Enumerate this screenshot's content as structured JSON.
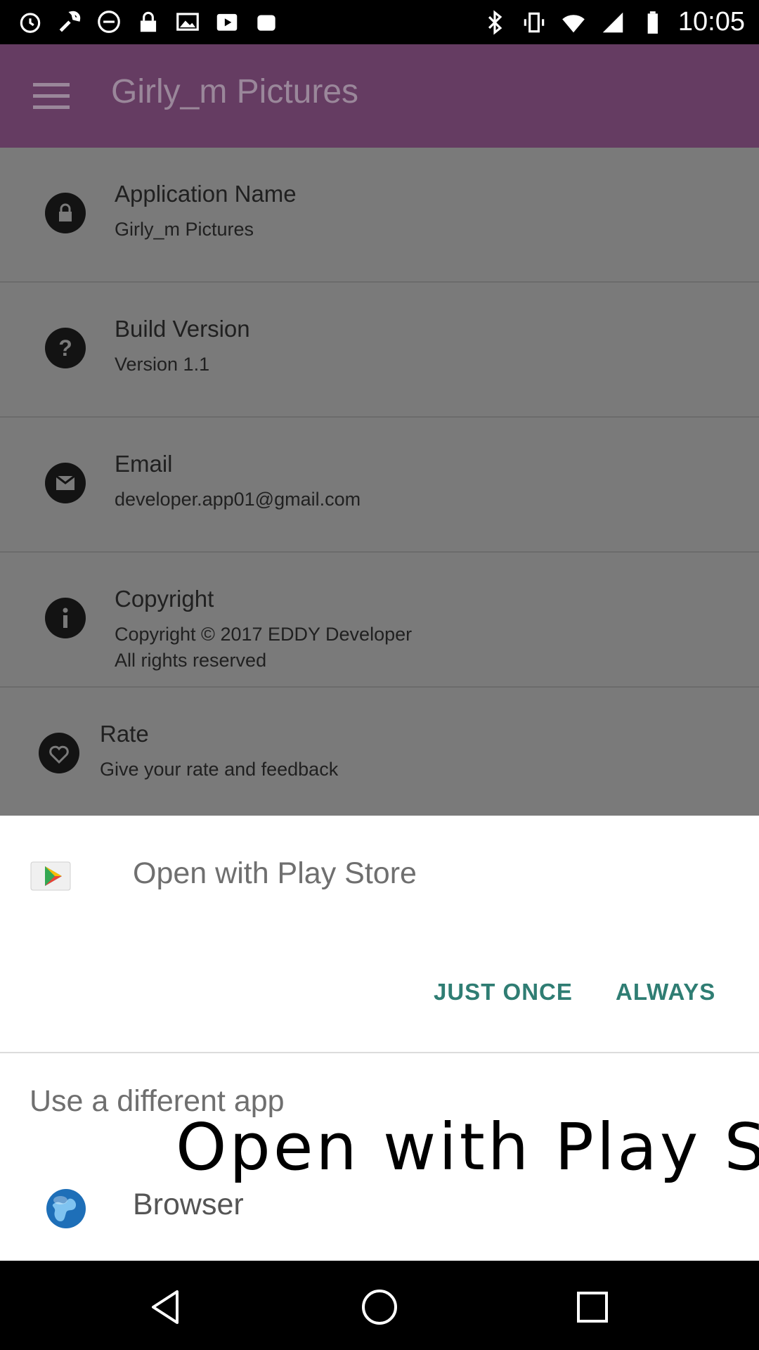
{
  "status_bar": {
    "time": "10:05",
    "left_icons": [
      "alarm-icon",
      "wrench-icon",
      "do-not-disturb-icon",
      "lock-icon",
      "photo-icon",
      "play-store-icon",
      "app-icon"
    ],
    "right_icons": [
      "bluetooth-icon",
      "vibrate-icon",
      "wifi-icon",
      "signal-icon",
      "battery-icon"
    ]
  },
  "app": {
    "title": "Girly_m Pictures",
    "toolbar_color": "#653c62",
    "rows": [
      {
        "icon": "lock-icon",
        "title": "Application Name",
        "subtitle": "Girly_m Pictures"
      },
      {
        "icon": "help-icon",
        "title": "Build Version",
        "subtitle": "Version 1.1"
      },
      {
        "icon": "email-icon",
        "title": "Email",
        "subtitle": "developer.app01@gmail.com"
      },
      {
        "icon": "info-icon",
        "title": "Copyright",
        "subtitle": "Copyright © 2017 EDDY Developer\n All rights reserved"
      },
      {
        "icon": "heart-icon",
        "title": "Rate",
        "subtitle": "Give your rate and feedback"
      }
    ]
  },
  "dialog": {
    "title": "Open with Play Store",
    "just_once": "JUST ONCE",
    "always": "ALWAYS",
    "accent_color": "#2f7d73",
    "different_app_label": "Use a different app",
    "overlay_caption": "Open with Play St",
    "apps": [
      {
        "name": "Browser",
        "icon": "globe-icon"
      }
    ]
  }
}
